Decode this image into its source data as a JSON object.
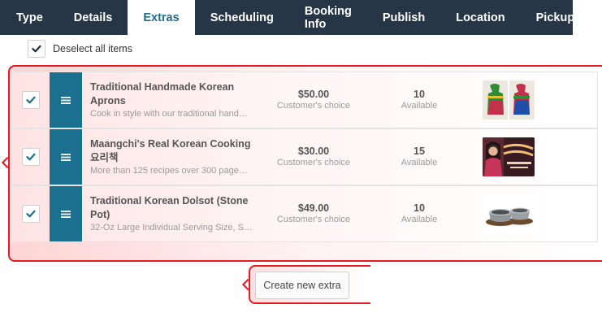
{
  "tabs": [
    {
      "label": "Type"
    },
    {
      "label": "Details"
    },
    {
      "label": "Extras"
    },
    {
      "label": "Scheduling"
    },
    {
      "label": "Booking Info"
    },
    {
      "label": "Publish"
    },
    {
      "label": "Location"
    },
    {
      "label": "Pickups"
    }
  ],
  "active_tab": "Extras",
  "deselect_all": {
    "label": "Deselect all items",
    "checked": true
  },
  "extras": [
    {
      "checked": true,
      "title": "Traditional Handmade Korean Aprons",
      "description": "Cook in style with our traditional hand…",
      "price": "$50.00",
      "price_note": "Customer's choice",
      "quantity": "10",
      "quantity_note": "Available",
      "image": "aprons-photo"
    },
    {
      "checked": true,
      "title": "Maangchi's Real Korean Cooking 요리책",
      "description": "More than 125 recipes over 300 page…",
      "price": "$30.00",
      "price_note": "Customer's choice",
      "quantity": "15",
      "quantity_note": "Available",
      "image": "cookbook-photo"
    },
    {
      "checked": true,
      "title": "Traditional Korean Dolsot (Stone Pot)",
      "description": "32-Oz Large Individual Serving Size, S…",
      "price": "$49.00",
      "price_note": "Customer's choice",
      "quantity": "10",
      "quantity_note": "Available",
      "image": "stone-pot-photo"
    }
  ],
  "create_button": {
    "label": "Create new extra"
  },
  "colors": {
    "tabbar": "#263646",
    "active_tab_text": "#1f6d8c",
    "drag_handle": "#1b7090",
    "highlight": "#e41b23"
  }
}
